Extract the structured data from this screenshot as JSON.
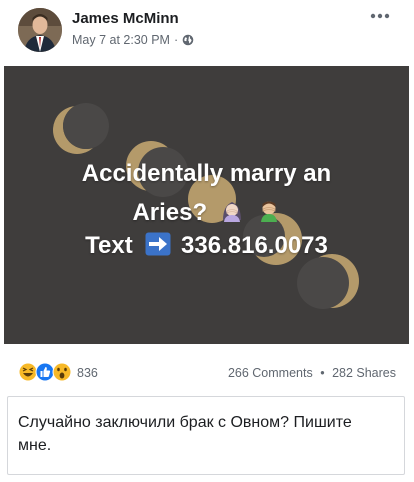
{
  "post": {
    "author": {
      "name": "James McMinn",
      "avatar_icon": "person-avatar-icon"
    },
    "timestamp": "May 7 at 2:30 PM",
    "meta_separator": "·",
    "privacy_icon": "globe-icon",
    "menu_icon": "more-options-icon",
    "image": {
      "background_color": "#3f3d3c",
      "moon_color": "#b49a6a",
      "line1": "Accidentally marry an",
      "line2": "Aries?",
      "line3_prefix": "Text",
      "line3_number": "336.816.0073",
      "emojis": [
        "woman-facepalming-icon",
        "man-facepalming-icon"
      ],
      "arrow_icon": "right-arrow-icon",
      "arrow_color": "#3b73c9"
    },
    "reactions": {
      "icons": [
        "haha-reaction-icon",
        "like-reaction-icon",
        "wow-reaction-icon"
      ],
      "count": "836"
    },
    "stats": {
      "comments": "266 Comments",
      "separator": "•",
      "shares": "282 Shares"
    },
    "comment": {
      "text": "Случайно заключили брак с Овном? Пишите мне."
    }
  }
}
